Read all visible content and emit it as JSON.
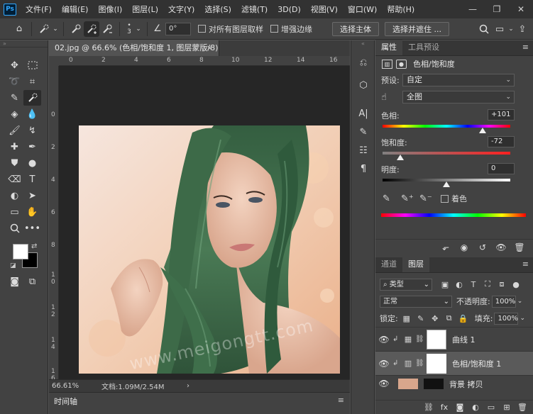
{
  "app": {
    "logo_text": "Ps"
  },
  "menu": [
    "文件(F)",
    "编辑(E)",
    "图像(I)",
    "图层(L)",
    "文字(Y)",
    "选择(S)",
    "滤镜(T)",
    "3D(D)",
    "视图(V)",
    "窗口(W)",
    "帮助(H)"
  ],
  "options_bar": {
    "brush_size": "3",
    "angle": "0°",
    "sample_all_layers": "对所有图层取样",
    "enhance_edge": "增强边缘",
    "select_subject": "选择主体",
    "select_and_mask": "选择并遮住 ..."
  },
  "document": {
    "tab_title": "02.jpg @ 66.6% (色相/饱和度 1, 图层蒙版/8) *",
    "close_glyph": "×",
    "ruler_top": [
      "0",
      "2",
      "4",
      "6",
      "8",
      "10",
      "12",
      "14",
      "16"
    ],
    "ruler_left": [
      "0",
      "2",
      "4",
      "6",
      "8",
      "1\n0",
      "1\n2",
      "1\n4",
      "1\n6"
    ],
    "zoom": "66.61%",
    "doc_info": "文档:1.09M/2.54M",
    "status_arrow": "›",
    "timeline_label": "时间轴",
    "watermark": "www.meigongtt.com"
  },
  "properties": {
    "tabs": [
      "属性",
      "工具预设"
    ],
    "header": "色相/饱和度",
    "preset_label": "预设:",
    "preset_value": "自定",
    "channel_value": "全图",
    "hue_label": "色相:",
    "hue_value": "+101",
    "hue_level": 101,
    "saturation_label": "饱和度:",
    "saturation_value": "-72",
    "saturation_level": -72,
    "lightness_label": "明度:",
    "lightness_value": "0",
    "lightness_level": 0,
    "colorize_label": "着色"
  },
  "layers": {
    "tabs": [
      "通道",
      "图层"
    ],
    "filter_kind": "类型",
    "blend_mode": "正常",
    "opacity_label": "不透明度:",
    "opacity_value": "100%",
    "lock_label": "锁定:",
    "fill_label": "填充:",
    "fill_value": "100%",
    "items": [
      {
        "name": "曲线 1",
        "selected": false
      },
      {
        "name": "色相/饱和度 1",
        "selected": true
      },
      {
        "name": "背景 拷贝",
        "selected": false
      }
    ]
  },
  "colors": {
    "accent_bg": "#424242",
    "menubar_bg": "#323232",
    "canvas_bg": "#282828",
    "hair_green": "#3f6b4a"
  }
}
